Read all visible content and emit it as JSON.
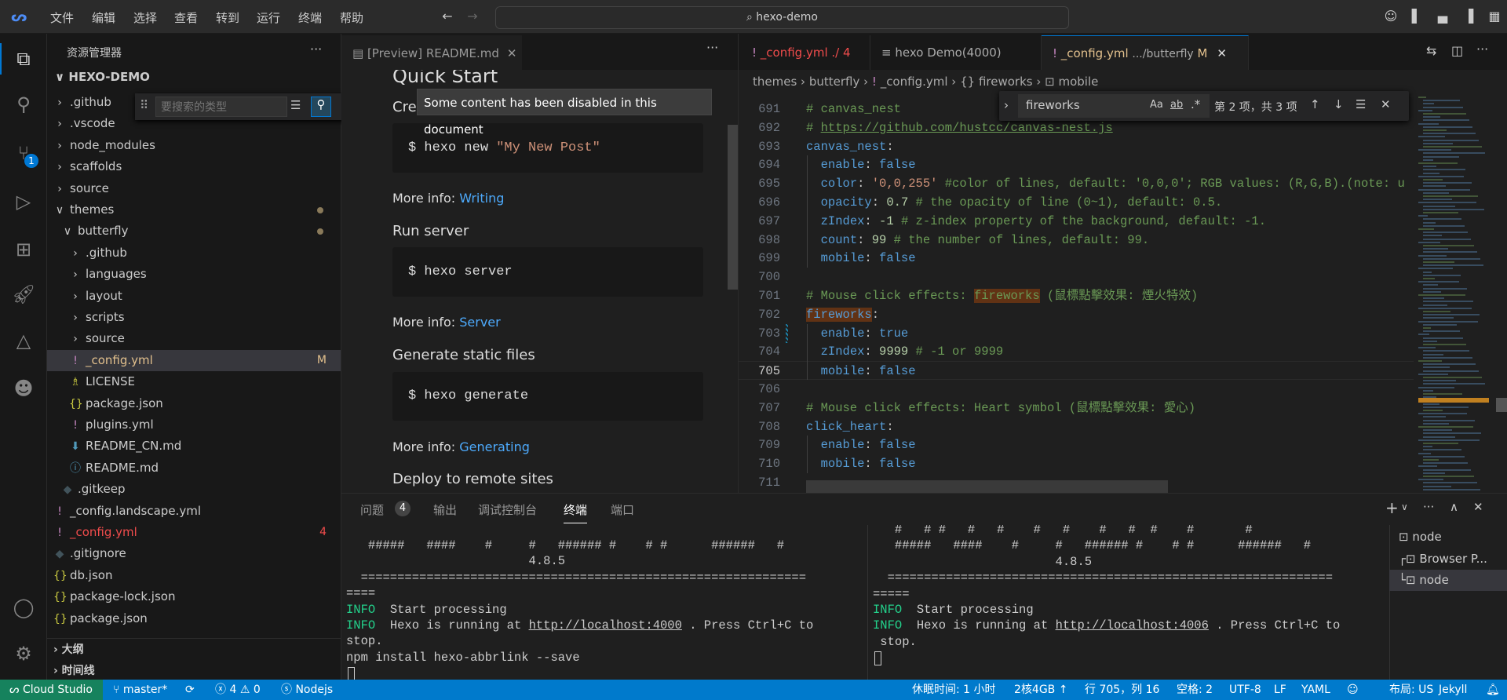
{
  "titlebar": {
    "menu": [
      "文件",
      "编辑",
      "选择",
      "查看",
      "转到",
      "运行",
      "终端",
      "帮助"
    ],
    "search": "hexo-demo"
  },
  "sidebar": {
    "title": "资源管理器",
    "root": "HEXO-DEMO",
    "filter_placeholder": "要搜索的类型",
    "items": [
      {
        "label": ".github",
        "type": "folder",
        "depth": 0
      },
      {
        "label": ".vscode",
        "type": "folder",
        "depth": 0
      },
      {
        "label": "node_modules",
        "type": "folder",
        "depth": 0
      },
      {
        "label": "scaffolds",
        "type": "folder",
        "depth": 0
      },
      {
        "label": "source",
        "type": "folder",
        "depth": 0
      },
      {
        "label": "themes",
        "type": "folder-open",
        "depth": 0,
        "dot": true
      },
      {
        "label": "butterfly",
        "type": "folder-open",
        "depth": 1,
        "dot": true
      },
      {
        "label": ".github",
        "type": "folder",
        "depth": 2
      },
      {
        "label": "languages",
        "type": "folder",
        "depth": 2
      },
      {
        "label": "layout",
        "type": "folder",
        "depth": 2
      },
      {
        "label": "scripts",
        "type": "folder",
        "depth": 2
      },
      {
        "label": "source",
        "type": "folder",
        "depth": 2
      },
      {
        "label": "_config.yml",
        "type": "yaml",
        "depth": 2,
        "badge": "M",
        "selected": true
      },
      {
        "label": "LICENSE",
        "type": "license",
        "depth": 2
      },
      {
        "label": "package.json",
        "type": "json",
        "depth": 2
      },
      {
        "label": "plugins.yml",
        "type": "yaml",
        "depth": 2
      },
      {
        "label": "README_CN.md",
        "type": "md-down",
        "depth": 2
      },
      {
        "label": "README.md",
        "type": "md-info",
        "depth": 2
      },
      {
        "label": ".gitkeep",
        "type": "git",
        "depth": 1
      },
      {
        "label": "_config.landscape.yml",
        "type": "yaml",
        "depth": 0
      },
      {
        "label": "_config.yml",
        "type": "yaml",
        "depth": 0,
        "badge": "4",
        "error": true
      },
      {
        "label": ".gitignore",
        "type": "git",
        "depth": 0
      },
      {
        "label": "db.json",
        "type": "json",
        "depth": 0
      },
      {
        "label": "package-lock.json",
        "type": "json",
        "depth": 0
      },
      {
        "label": "package.json",
        "type": "json",
        "depth": 0
      }
    ],
    "outline": "大纲",
    "timeline": "时间线"
  },
  "preview": {
    "tab": "[Preview] README.md",
    "tooltip": "Some content has been disabled in this document",
    "heading": "Quick Start",
    "create_partial": "Create a new post",
    "cmd1_prefix": "$ hexo new ",
    "cmd1_arg": "\"My New Post\"",
    "more_info": "More info: ",
    "link1": "Writing",
    "h_run": "Run server",
    "cmd2": "$ hexo server",
    "link2": "Server",
    "h_gen": "Generate static files",
    "cmd3": "$ hexo generate",
    "link3": "Generating",
    "h_deploy": "Deploy to remote sites"
  },
  "editor": {
    "tabs": [
      {
        "icon": "!",
        "name": "_config.yml",
        "desc": "./ 4",
        "error": true
      },
      {
        "icon": "≡",
        "name": "hexo Demo(4000)",
        "desc": ""
      },
      {
        "icon": "!",
        "name": "_config.yml",
        "desc": ".../butterfly",
        "badge": "M",
        "active": true
      }
    ],
    "breadcrumb": [
      "themes",
      "butterfly",
      "_config.yml",
      "fireworks",
      "mobile"
    ],
    "find": {
      "query": "fireworks",
      "case": "Aa",
      "word": "ab",
      "regex": ".*",
      "result": "第 2 项，共 3 项"
    },
    "current_line": 705,
    "lines": [
      {
        "n": 691,
        "t": [
          [
            "c",
            "# canvas_nest"
          ]
        ]
      },
      {
        "n": 692,
        "t": [
          [
            "c",
            "# "
          ],
          [
            "u",
            "https://github.com/hustcc/canvas-nest.js"
          ]
        ]
      },
      {
        "n": 693,
        "t": [
          [
            "k",
            "canvas_nest"
          ],
          [
            "p",
            ":"
          ]
        ]
      },
      {
        "n": 694,
        "t": [
          [
            "p",
            "  "
          ],
          [
            "k",
            "enable"
          ],
          [
            "p",
            ": "
          ],
          [
            "b",
            "false"
          ]
        ]
      },
      {
        "n": 695,
        "t": [
          [
            "p",
            "  "
          ],
          [
            "k",
            "color"
          ],
          [
            "p",
            ": "
          ],
          [
            "s",
            "'0,0,255'"
          ],
          [
            "c",
            " #color of lines, default: '0,0,0'; RGB values: (R,G,B).(note: u"
          ]
        ]
      },
      {
        "n": 696,
        "t": [
          [
            "p",
            "  "
          ],
          [
            "k",
            "opacity"
          ],
          [
            "p",
            ": "
          ],
          [
            "n",
            "0.7"
          ],
          [
            "c",
            " # the opacity of line (0~1), default: 0.5."
          ]
        ]
      },
      {
        "n": 697,
        "t": [
          [
            "p",
            "  "
          ],
          [
            "k",
            "zIndex"
          ],
          [
            "p",
            ": "
          ],
          [
            "n",
            "-1"
          ],
          [
            "c",
            " # z-index property of the background, default: -1."
          ]
        ]
      },
      {
        "n": 698,
        "t": [
          [
            "p",
            "  "
          ],
          [
            "k",
            "count"
          ],
          [
            "p",
            ": "
          ],
          [
            "n",
            "99"
          ],
          [
            "c",
            " # the number of lines, default: 99."
          ]
        ]
      },
      {
        "n": 699,
        "t": [
          [
            "p",
            "  "
          ],
          [
            "k",
            "mobile"
          ],
          [
            "p",
            ": "
          ],
          [
            "b",
            "false"
          ]
        ]
      },
      {
        "n": 700,
        "t": []
      },
      {
        "n": 701,
        "t": [
          [
            "c",
            "# Mouse click effects: "
          ],
          [
            "m",
            "fireworks"
          ],
          [
            "c",
            " (鼠標點擊效果: 煙火特效)"
          ]
        ]
      },
      {
        "n": 702,
        "t": [
          [
            "mk",
            "fireworks"
          ],
          [
            "p",
            ":"
          ]
        ]
      },
      {
        "n": 703,
        "t": [
          [
            "p",
            "  "
          ],
          [
            "k",
            "enable"
          ],
          [
            "p",
            ": "
          ],
          [
            "b",
            "true"
          ]
        ]
      },
      {
        "n": 704,
        "t": [
          [
            "p",
            "  "
          ],
          [
            "k",
            "zIndex"
          ],
          [
            "p",
            ": "
          ],
          [
            "n",
            "9999"
          ],
          [
            "c",
            " # -1 or 9999"
          ]
        ]
      },
      {
        "n": 705,
        "t": [
          [
            "p",
            "  "
          ],
          [
            "k",
            "mobile"
          ],
          [
            "p",
            ": "
          ],
          [
            "b",
            "false"
          ]
        ]
      },
      {
        "n": 706,
        "t": []
      },
      {
        "n": 707,
        "t": [
          [
            "c",
            "# Mouse click effects: Heart symbol (鼠標點擊效果: 愛心)"
          ]
        ]
      },
      {
        "n": 708,
        "t": [
          [
            "k",
            "click_heart"
          ],
          [
            "p",
            ":"
          ]
        ]
      },
      {
        "n": 709,
        "t": [
          [
            "p",
            "  "
          ],
          [
            "k",
            "enable"
          ],
          [
            "p",
            ": "
          ],
          [
            "b",
            "false"
          ]
        ]
      },
      {
        "n": 710,
        "t": [
          [
            "p",
            "  "
          ],
          [
            "k",
            "mobile"
          ],
          [
            "p",
            ": "
          ],
          [
            "b",
            "false"
          ]
        ]
      },
      {
        "n": 711,
        "t": []
      }
    ]
  },
  "panel": {
    "tabs": [
      "问题",
      "输出",
      "调试控制台",
      "终端",
      "端口"
    ],
    "problems_count": "4",
    "active_tab": "终端",
    "left_terminal": [
      [
        [
          "p",
          "   #####   ####    #     #   ###### #    # #      ######   #"
        ]
      ],
      [
        [
          "p",
          "                         4.8.5"
        ]
      ],
      [
        [
          "p",
          "  ============================================================="
        ]
      ],
      [
        [
          "p",
          "===="
        ]
      ],
      [
        [
          "i",
          "INFO"
        ],
        [
          "p",
          "  Start processing"
        ]
      ],
      [
        [
          "i",
          "INFO"
        ],
        [
          "p",
          "  Hexo is running at "
        ],
        [
          "u",
          "http://localhost:4000"
        ],
        [
          "p",
          " . Press Ctrl+C to"
        ]
      ],
      [
        [
          "p",
          "stop."
        ]
      ],
      [
        [
          "p",
          "npm install hexo-abbrlink --save"
        ]
      ]
    ],
    "right_terminal": [
      [
        [
          "p",
          "   #   # #   #   #    #   #    #   #  #    #       #"
        ]
      ],
      [
        [
          "p",
          "   #####   ####    #     #   ###### #    # #      ######   #"
        ]
      ],
      [
        [
          "p",
          "                         4.8.5"
        ]
      ],
      [
        [
          "p",
          "  ============================================================="
        ]
      ],
      [
        [
          "p",
          "====="
        ]
      ],
      [
        [
          "i",
          "INFO"
        ],
        [
          "p",
          "  Start processing"
        ]
      ],
      [
        [
          "i",
          "INFO"
        ],
        [
          "p",
          "  Hexo is running at "
        ],
        [
          "u",
          "http://localhost:4006"
        ],
        [
          "p",
          " . Press Ctrl+C to"
        ]
      ],
      [
        [
          "p",
          " stop."
        ]
      ]
    ],
    "terminals": [
      {
        "prefix": "",
        "name": "node"
      },
      {
        "prefix": "┌",
        "name": "Browser P..."
      },
      {
        "prefix": "└",
        "name": "node",
        "selected": true
      }
    ]
  },
  "status": {
    "remote": "Cloud Studio",
    "branch": "master*",
    "errors": "4",
    "warnings": "0",
    "env": "Nodejs",
    "sleep": "休眠时间: 1 小时",
    "machine": "2核4GB",
    "position": "行 705，列 16",
    "spaces": "空格: 2",
    "encoding": "UTF-8",
    "eol": "LF",
    "language": "YAML",
    "layout": "布局: US",
    "jekyll": "Jekyll"
  },
  "colors": {
    "accent": "#007acc",
    "remote": "#16825d",
    "comment": "#6a9955",
    "key": "#569cd6",
    "string": "#ce9178",
    "number": "#b5cea8",
    "find_match": "#613214",
    "error": "#f14c4c",
    "modified": "#e2c08d"
  }
}
